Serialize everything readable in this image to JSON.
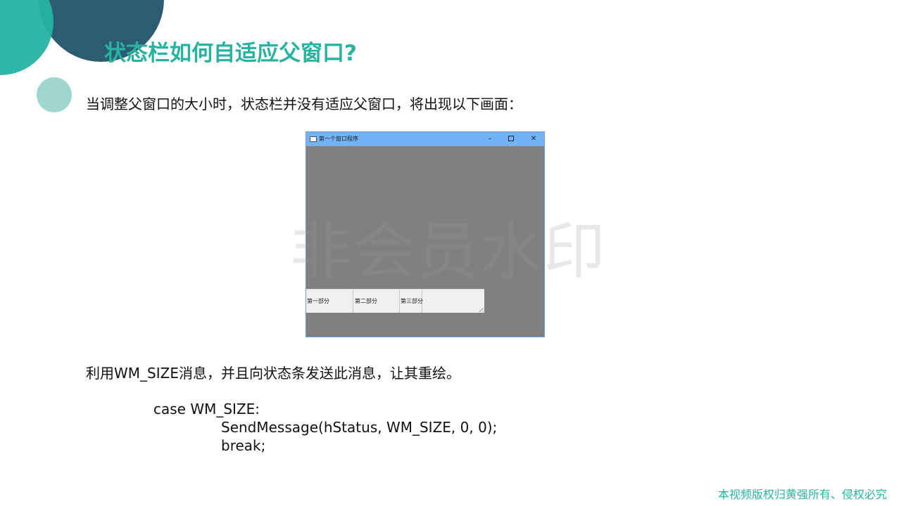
{
  "slide": {
    "title": "状态栏如何自适应父窗口?",
    "intro": "当调整父窗口的大小时，状态栏并没有适应父窗口，将出现以下画面：",
    "note": "利用WM_SIZE消息，并且向状态条发送此消息，让其重绘。",
    "code": {
      "line1": "case WM_SIZE:",
      "line2": "SendMessage(hStatus, WM_SIZE, 0, 0);",
      "line3": "break;"
    },
    "footer": "本视频版权归黄强所有、侵权必究",
    "watermark": "非会员水印"
  },
  "window": {
    "title": "第一个窗口程序",
    "min_glyph": "–",
    "close_glyph": "✕",
    "status_parts": [
      "第一部分",
      "第二部分",
      "第三部分"
    ]
  },
  "colors": {
    "accent": "#27b3a0",
    "navy": "#2b5c72",
    "light_teal": "#9fd6cd",
    "titlebar": "#72b3f5",
    "client_area": "#808080"
  }
}
